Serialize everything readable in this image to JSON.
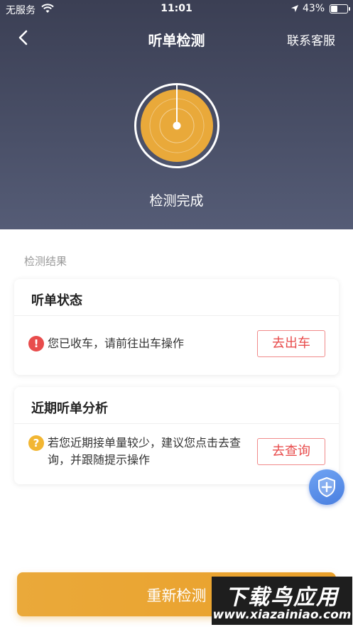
{
  "status_bar": {
    "carrier": "无服务",
    "time": "11:01",
    "battery_percent_text": "43%",
    "battery_level": 0.43,
    "wifi_icon": "wifi-icon",
    "location_icon": "location-arrow-icon"
  },
  "nav": {
    "back_icon": "chevron-left-icon",
    "title": "听单检测",
    "right_action": "联系客服"
  },
  "radar": {
    "status_text": "检测完成",
    "accent_color": "#e9a93a"
  },
  "results": {
    "section_label": "检测结果",
    "cards": [
      {
        "title": "听单状态",
        "icon": "exclamation-icon",
        "icon_glyph": "!",
        "message": "您已收车，请前往出车操作",
        "button_label": "去出车"
      },
      {
        "title": "近期听单分析",
        "icon": "question-icon",
        "icon_glyph": "?",
        "message": "若您近期接单量较少，建议您点击去查询，并跟随提示操作",
        "button_label": "去查询"
      }
    ]
  },
  "floating_button": {
    "icon": "shield-plus-icon"
  },
  "footer": {
    "main_button_label": "重新检测"
  },
  "watermark": {
    "title": "下载鸟应用",
    "url": "www.xiazainiao.com"
  },
  "colors": {
    "header_bg": "#454a62",
    "primary_orange": "#e9a02a",
    "danger_red": "#e84c4c",
    "warning_yellow": "#f2b632",
    "fab_blue": "#5a8ee8"
  }
}
